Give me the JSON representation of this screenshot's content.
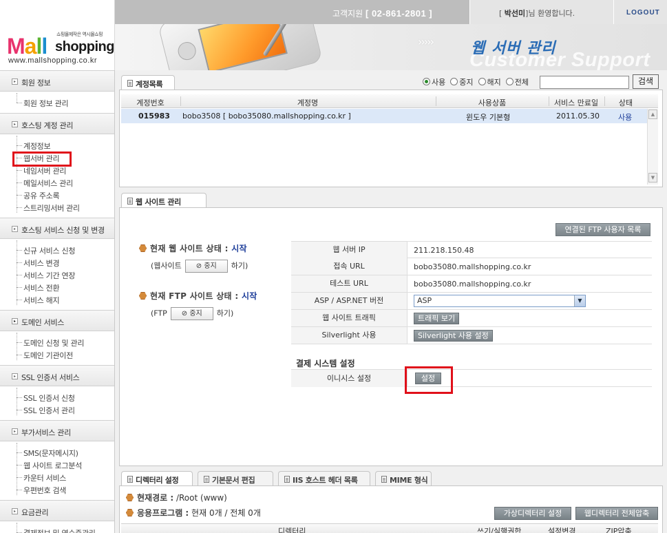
{
  "header": {
    "logo": {
      "tagline": "쇼핑몰제작은 역시몰쇼핑",
      "word_m": "M",
      "word_a": "a",
      "word_l1": "l",
      "word_l2": "l",
      "word_shop": "shopping",
      "url": "www.mallshopping.co.kr"
    },
    "support_label": "고객지원",
    "support_phone": "[ 02-861-2801 ]",
    "user_name": "박선미",
    "welcome_prefix": "[",
    "welcome_suffix": "]님 환영합니다.",
    "logout": "LOGOUT",
    "banner_title": "웹 서버 관리",
    "banner_sub": "Customer Support"
  },
  "sidebar": {
    "sections": [
      {
        "label": "회원 정보",
        "items": [
          "회원 정보 관리"
        ]
      },
      {
        "label": "호스팅 계정 관리",
        "items": [
          "계정정보",
          "웹서버 관리",
          "네임서버 관리",
          "메일서비스 관리",
          "공유 주소록",
          "스트리밍서버 관리"
        ]
      },
      {
        "label": "호스팅 서비스 신청 및 변경",
        "items": [
          "신규 서비스 신청",
          "서비스 변경",
          "서비스 기간 연장",
          "서비스 전환",
          "서비스 해지"
        ]
      },
      {
        "label": "도메인 서비스",
        "items": [
          "도메인 신청 및 관리",
          "도메인 기관이전"
        ]
      },
      {
        "label": "SSL 인증서 서비스",
        "items": [
          "SSL 인증서 신청",
          "SSL 인증서 관리"
        ]
      },
      {
        "label": "부가서비스 관리",
        "items": [
          "SMS(문자메시지)",
          "웹 사이트 로그분석",
          "카운터 서비스",
          "우편번호 검색"
        ]
      },
      {
        "label": "요금관리",
        "items": [
          "결제정보 및 영수증관리"
        ]
      }
    ]
  },
  "accounts": {
    "tab_label": "계정목록",
    "filter": {
      "options": [
        "사용",
        "중지",
        "해지",
        "전체"
      ],
      "selected": "사용",
      "search_value": "",
      "search_button": "검색"
    },
    "columns": [
      "계정번호",
      "계정명",
      "사용상품",
      "서비스 만료일",
      "상태"
    ],
    "rows": [
      {
        "id": "015983",
        "name": "bobo3508 [ bobo35080.mallshopping.co.kr ]",
        "product": "윈도우 기본형",
        "expires": "2011.05.30",
        "status": "사용"
      }
    ]
  },
  "website": {
    "tab_label": "웹 사이트 관리",
    "ftp_users_button": "연결된 FTP 사용자 목록",
    "web_status_label": "현재 웹 사이트 상태 :",
    "web_status_value": "시작",
    "web_prefix": "(웹사이트",
    "web_stop": "⊘ 중지",
    "web_suffix": "하기)",
    "ftp_status_label": "현재 FTP 사이트 상태 :",
    "ftp_status_value": "시작",
    "ftp_prefix": "(FTP",
    "ftp_stop": "⊘ 중지",
    "ftp_suffix": "하기)",
    "info": {
      "web_ip_label": "웹 서버 IP",
      "web_ip": "211.218.150.48",
      "access_url_label": "접속 URL",
      "access_url": "bobo35080.mallshopping.co.kr",
      "test_url_label": "테스트 URL",
      "test_url": "bobo35080.mallshopping.co.kr",
      "asp_label": "ASP / ASP.NET 버전",
      "asp_value": "ASP",
      "traffic_label": "웹 사이트 트래픽",
      "traffic_button": "트래픽 보기",
      "silverlight_label": "Silverlight 사용",
      "silverlight_button": "Silverlight 사용 설정"
    },
    "payment_heading": "결제 시스템 설정",
    "inicis_label": "이니시스 설정",
    "inicis_button": "설정"
  },
  "directory": {
    "tabs": [
      "디렉터리 설정",
      "기본문서 편집",
      "IIS 호스트 헤더 목록",
      "MIME 형식"
    ],
    "current_path_label": "현재경로 :",
    "current_path": "/Root (www)",
    "apps_label": "응용프로그램 :",
    "apps_value": "현재 0개 / 전체 0개",
    "virtual_dir_button": "가상디렉터리 설정",
    "compress_button": "웹디렉터리 전체압축",
    "columns": [
      "디렉터리",
      "쓰기/실행권한",
      "설정변경",
      "ZIP압축"
    ]
  }
}
